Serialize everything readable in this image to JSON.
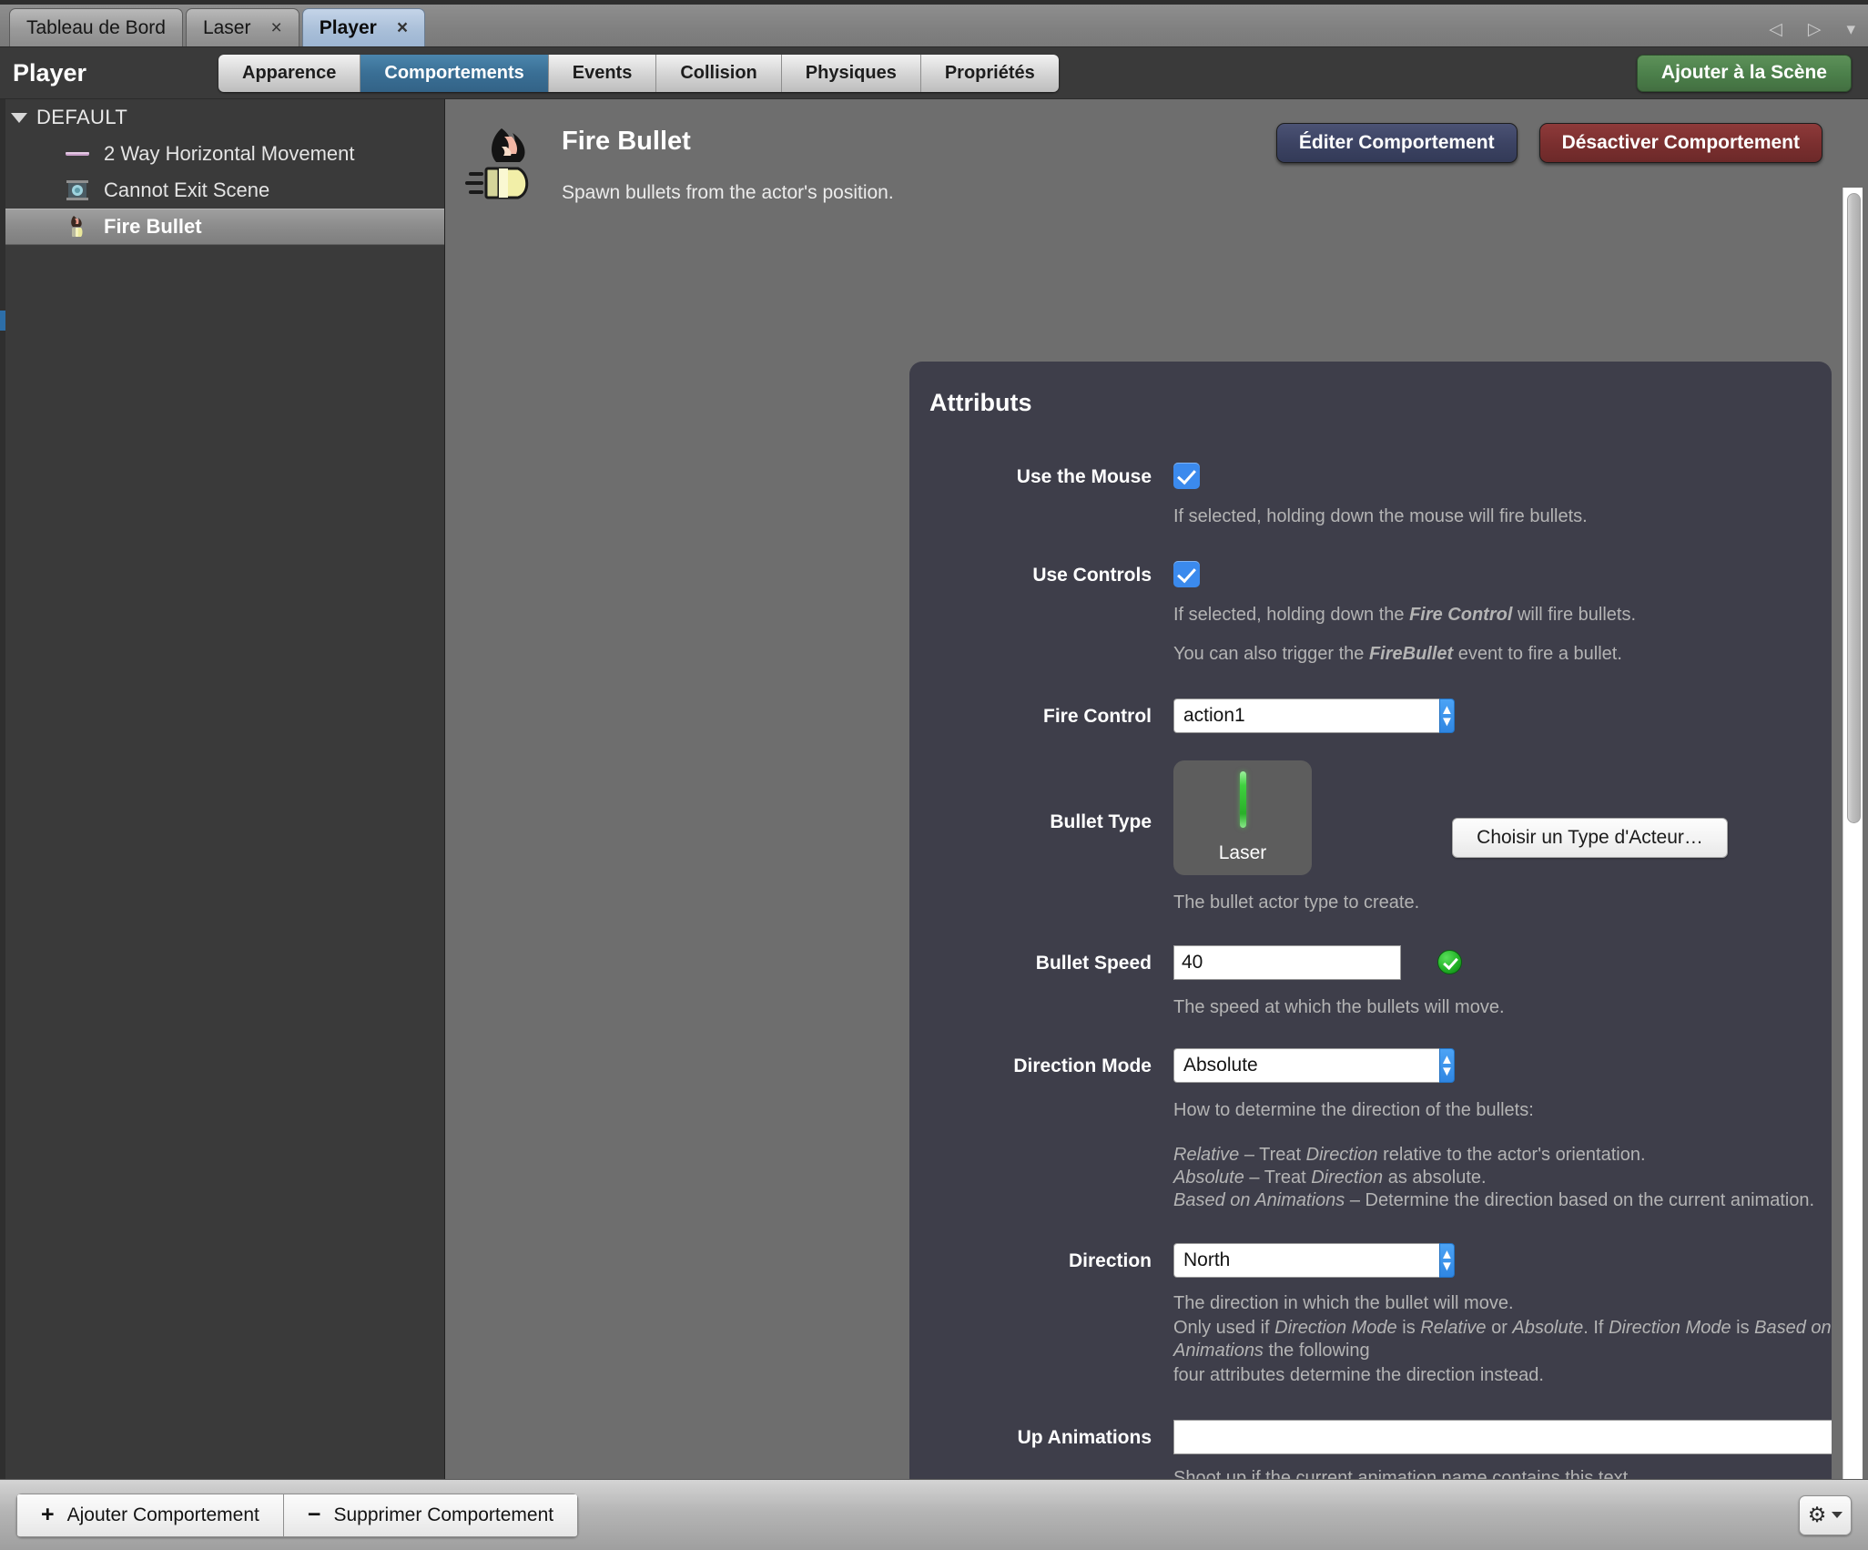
{
  "window": {
    "tabs": [
      {
        "label": "Tableau de Bord",
        "closable": false,
        "active": false
      },
      {
        "label": "Laser",
        "closable": true,
        "active": false
      },
      {
        "label": "Player",
        "closable": true,
        "active": true
      }
    ],
    "close_glyph": "×",
    "nav": {
      "prev": "◁",
      "next": "▷",
      "list": "▾"
    }
  },
  "header": {
    "title": "Player",
    "tabs": [
      {
        "label": "Apparence",
        "active": false
      },
      {
        "label": "Comportements",
        "active": true
      },
      {
        "label": "Events",
        "active": false
      },
      {
        "label": "Collision",
        "active": false
      },
      {
        "label": "Physiques",
        "active": false
      },
      {
        "label": "Propriétés",
        "active": false
      }
    ],
    "add_to_scene_label": "Ajouter à la Scène",
    "accent_blue": "#3a6f95",
    "accent_green": "#4b7f4a"
  },
  "sidebar": {
    "group_label": "DEFAULT",
    "items": [
      {
        "label": "2 Way Horizontal Movement",
        "icon": "horizontal-arrow-icon",
        "selected": false
      },
      {
        "label": "Cannot Exit Scene",
        "icon": "scene-box-icon",
        "selected": false
      },
      {
        "label": "Fire Bullet",
        "icon": "fire-bullet-icon",
        "selected": true
      }
    ]
  },
  "behavior": {
    "icon": "fire-bullet-icon",
    "title": "Fire Bullet",
    "description": "Spawn bullets from the actor's position.",
    "edit_label": "Éditer Comportement",
    "disable_label": "Désactiver Comportement"
  },
  "attributes": {
    "section_title": "Attributs",
    "use_the_mouse": {
      "label": "Use the Mouse",
      "checked": true,
      "hint": "If selected, holding down the mouse will fire bullets."
    },
    "use_controls": {
      "label": "Use Controls",
      "checked": true,
      "hint_prefix": "If selected, holding down the ",
      "hint_em": "Fire Control",
      "hint_suffix": " will fire bullets.",
      "hint2_prefix": "You can also trigger the ",
      "hint2_em": "FireBullet",
      "hint2_suffix": " event to fire a bullet."
    },
    "fire_control": {
      "label": "Fire Control",
      "value": "action1",
      "options": [
        "action1"
      ]
    },
    "bullet_type": {
      "label": "Bullet Type",
      "preview_name": "Laser",
      "choose_label": "Choisir un Type d'Acteur…",
      "hint": "The bullet actor type to create."
    },
    "bullet_speed": {
      "label": "Bullet Speed",
      "value": "40",
      "status": "valid",
      "hint": "The speed at which the bullets will move."
    },
    "direction_mode": {
      "label": "Direction Mode",
      "value": "Absolute",
      "options": [
        "Relative",
        "Absolute",
        "Based on Animations"
      ],
      "hint": "How to determine the direction of the bullets:",
      "lines": [
        {
          "em": "Relative",
          "rest_a": " – Treat ",
          "em2": "Direction",
          "rest_b": " relative to the actor's orientation."
        },
        {
          "em": "Absolute",
          "rest_a": " – Treat ",
          "em2": "Direction",
          "rest_b": " as absolute."
        },
        {
          "em": "Based on Animations",
          "rest_a": " – Determine the direction based on the current animation.",
          "em2": "",
          "rest_b": ""
        }
      ]
    },
    "direction": {
      "label": "Direction",
      "value": "North",
      "options": [
        "North"
      ],
      "hint1": "The direction in which the bullet will move.",
      "hint2_a": "Only used if ",
      "hint2_em1": "Direction Mode",
      "hint2_b": " is ",
      "hint2_em2": "Relative",
      "hint2_c": " or ",
      "hint2_em3": "Absolute",
      "hint2_d": ". If ",
      "hint2_em4": "Direction Mode",
      "hint2_e": " is ",
      "hint2_em5": "Based on Animations",
      "hint2_f": " the following",
      "hint3": "four attributes determine the direction instead."
    },
    "up_animations": {
      "label": "Up Animations",
      "value": "",
      "hint": "Shoot up if the current animation name contains this text."
    }
  },
  "footer": {
    "add_behavior_label": "Ajouter Comportement",
    "remove_behavior_label": "Supprimer Comportement",
    "add_symbol": "+",
    "remove_symbol": "−",
    "gear_glyph": "⚙"
  }
}
